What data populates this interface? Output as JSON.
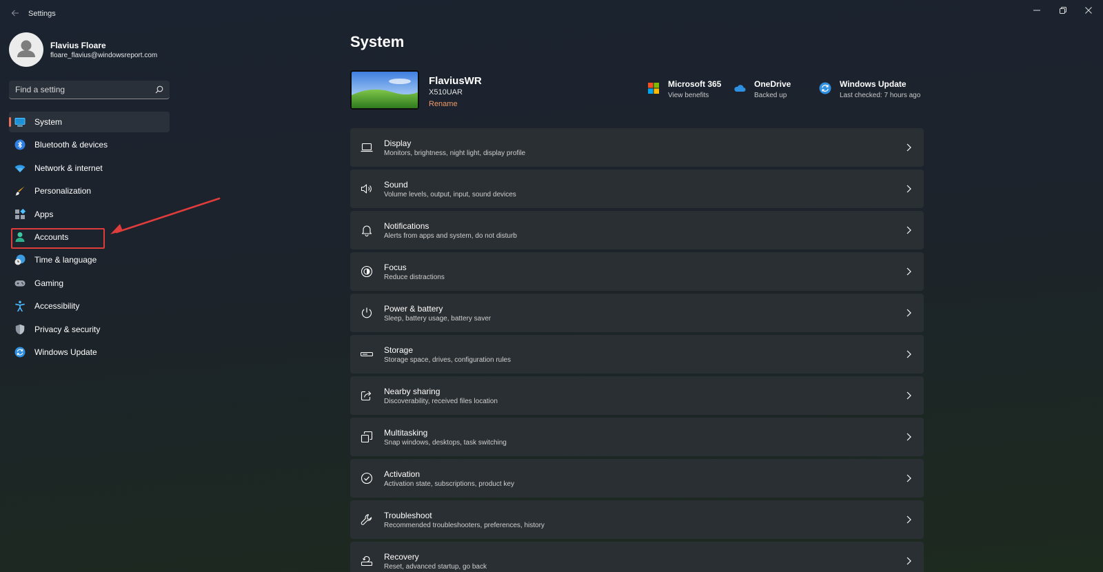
{
  "window": {
    "title": "Settings",
    "back_icon": "back-arrow-icon",
    "controls": [
      "minimize-icon",
      "restore-icon",
      "close-icon"
    ]
  },
  "user": {
    "name": "Flavius Floare",
    "email": "floare_flavius@windowsreport.com"
  },
  "search": {
    "placeholder": "Find a setting",
    "value": ""
  },
  "sidebar": {
    "items": [
      {
        "label": "System",
        "icon": "monitor-icon",
        "active": true
      },
      {
        "label": "Bluetooth & devices",
        "icon": "bluetooth-icon"
      },
      {
        "label": "Network & internet",
        "icon": "wifi-icon"
      },
      {
        "label": "Personalization",
        "icon": "paintbrush-icon"
      },
      {
        "label": "Apps",
        "icon": "apps-grid-icon"
      },
      {
        "label": "Accounts",
        "icon": "person-icon",
        "highlighted": true
      },
      {
        "label": "Time & language",
        "icon": "globe-clock-icon"
      },
      {
        "label": "Gaming",
        "icon": "gamepad-icon"
      },
      {
        "label": "Accessibility",
        "icon": "accessibility-icon"
      },
      {
        "label": "Privacy & security",
        "icon": "shield-icon"
      },
      {
        "label": "Windows Update",
        "icon": "sync-icon"
      }
    ]
  },
  "main": {
    "title": "System",
    "device": {
      "name": "FlaviusWR",
      "model": "X510UAR",
      "rename_label": "Rename"
    },
    "tiles": [
      {
        "title": "Microsoft 365",
        "subtitle": "View benefits",
        "icon": "microsoft-logo-icon"
      },
      {
        "title": "OneDrive",
        "subtitle": "Backed up",
        "icon": "cloud-icon"
      },
      {
        "title": "Windows Update",
        "subtitle": "Last checked: 7 hours ago",
        "icon": "sync-icon"
      }
    ],
    "cards": [
      {
        "title": "Display",
        "subtitle": "Monitors, brightness, night light, display profile",
        "icon": "laptop-icon"
      },
      {
        "title": "Sound",
        "subtitle": "Volume levels, output, input, sound devices",
        "icon": "speaker-icon"
      },
      {
        "title": "Notifications",
        "subtitle": "Alerts from apps and system, do not disturb",
        "icon": "bell-icon"
      },
      {
        "title": "Focus",
        "subtitle": "Reduce distractions",
        "icon": "focus-icon"
      },
      {
        "title": "Power & battery",
        "subtitle": "Sleep, battery usage, battery saver",
        "icon": "power-icon"
      },
      {
        "title": "Storage",
        "subtitle": "Storage space, drives, configuration rules",
        "icon": "storage-drive-icon"
      },
      {
        "title": "Nearby sharing",
        "subtitle": "Discoverability, received files location",
        "icon": "share-icon"
      },
      {
        "title": "Multitasking",
        "subtitle": "Snap windows, desktops, task switching",
        "icon": "multitasking-icon"
      },
      {
        "title": "Activation",
        "subtitle": "Activation state, subscriptions, product key",
        "icon": "check-circle-icon"
      },
      {
        "title": "Troubleshoot",
        "subtitle": "Recommended troubleshooters, preferences, history",
        "icon": "wrench-icon"
      },
      {
        "title": "Recovery",
        "subtitle": "Reset, advanced startup, go back",
        "icon": "recovery-icon"
      }
    ]
  },
  "colors": {
    "accent": "#e8725a",
    "highlight": "#e03c3c",
    "card_bg": "#2a2f33"
  }
}
